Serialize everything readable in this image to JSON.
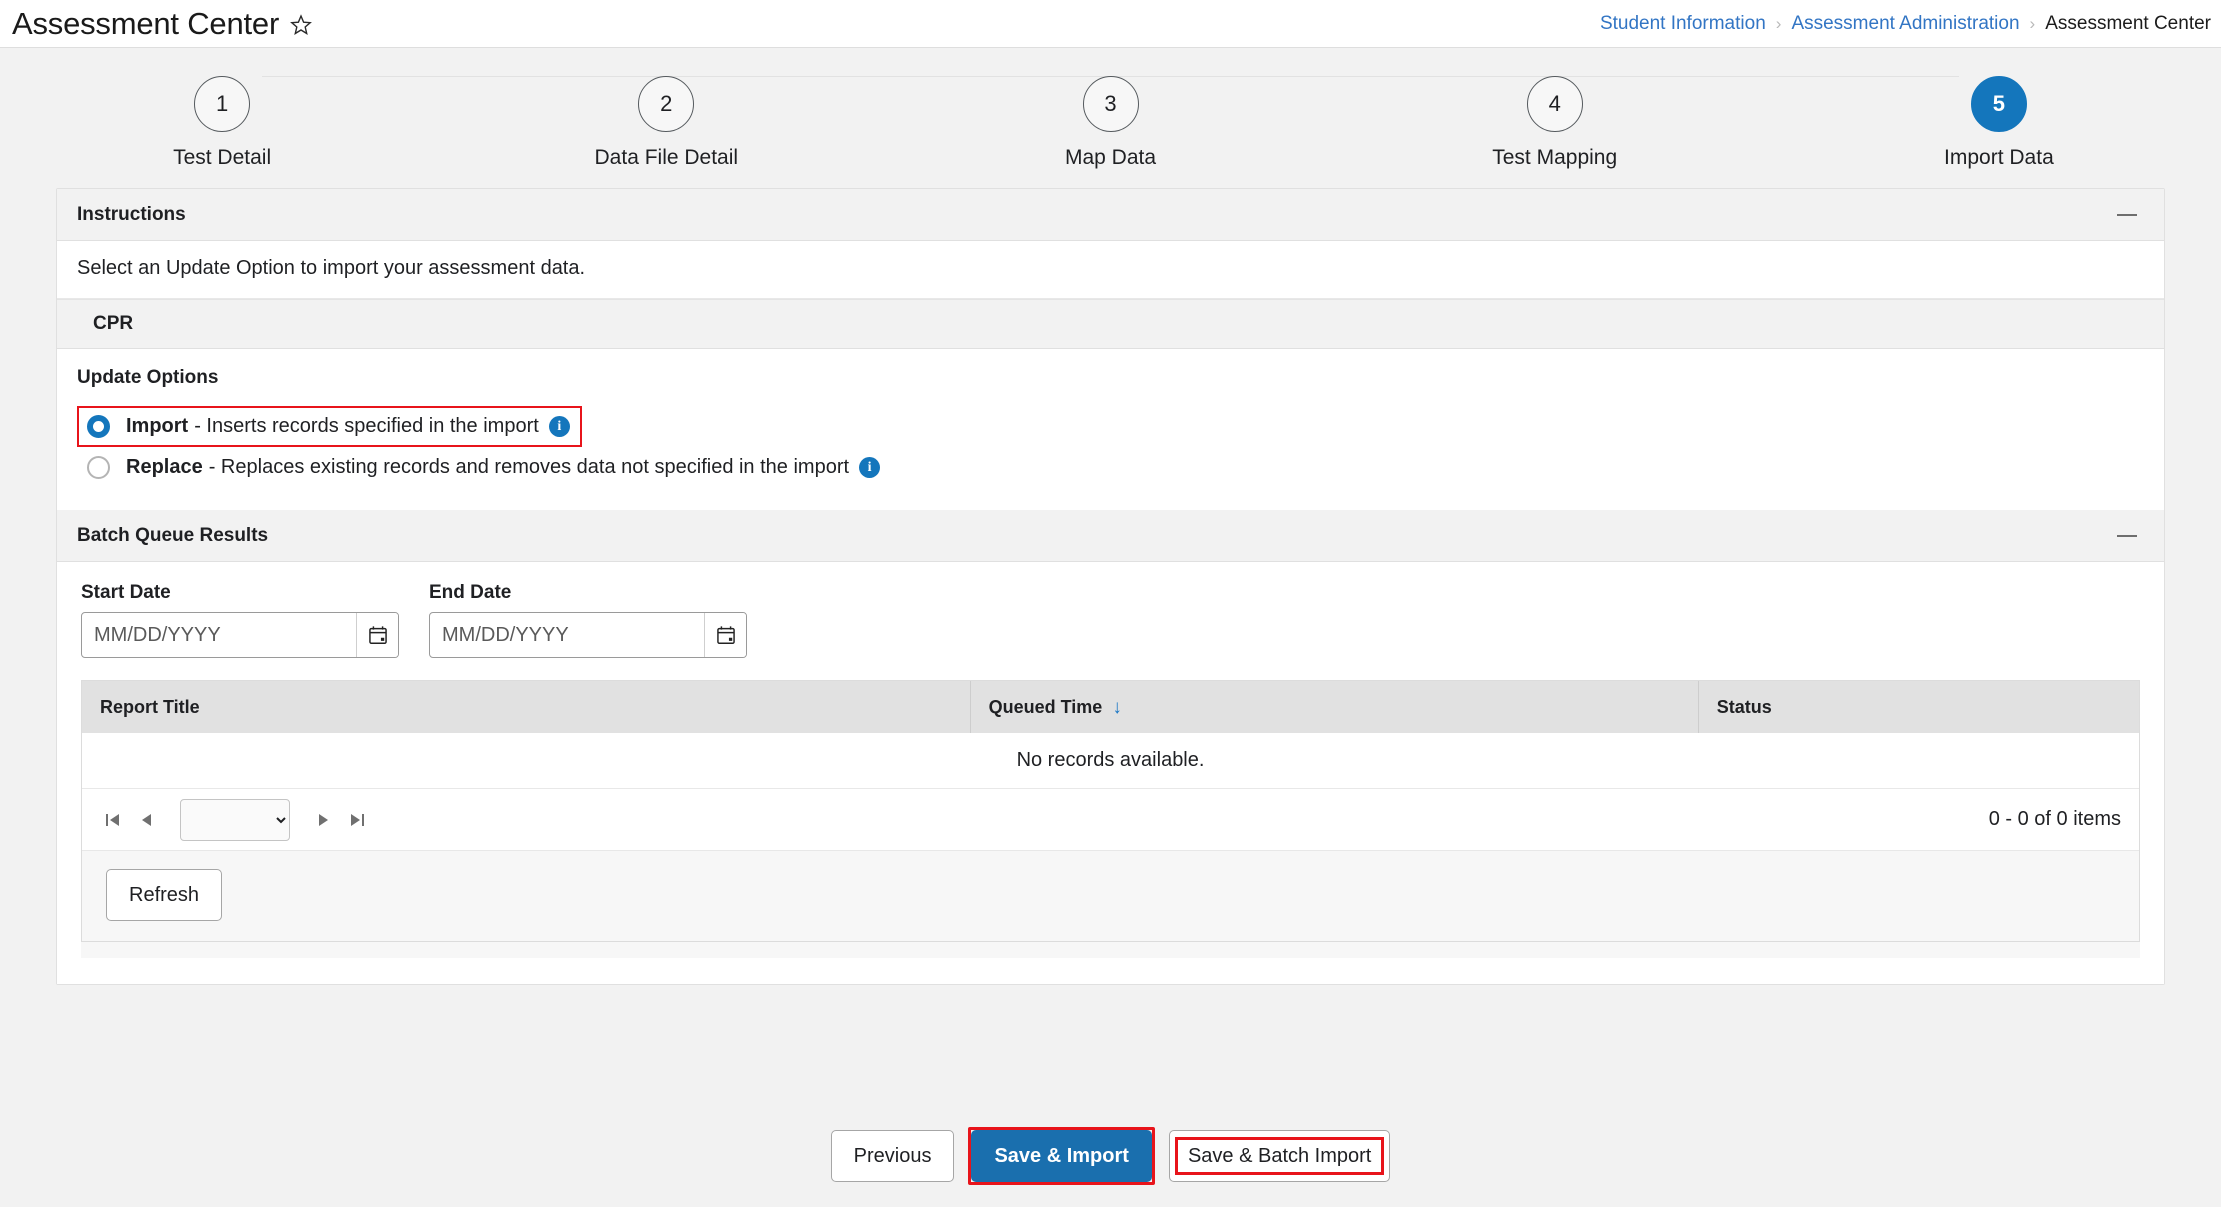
{
  "header": {
    "title": "Assessment Center",
    "favorite_icon": "star-icon",
    "breadcrumb": {
      "items": [
        "Student Information",
        "Assessment Administration",
        "Assessment Center"
      ],
      "separator": "›"
    }
  },
  "stepper": {
    "steps": [
      {
        "number": "1",
        "label": "Test Detail",
        "active": false
      },
      {
        "number": "2",
        "label": "Data File Detail",
        "active": false
      },
      {
        "number": "3",
        "label": "Map Data",
        "active": false
      },
      {
        "number": "4",
        "label": "Test Mapping",
        "active": false
      },
      {
        "number": "5",
        "label": "Import Data",
        "active": true
      }
    ],
    "active_color": "#1476bc"
  },
  "instructions": {
    "panel_title": "Instructions",
    "collapse_icon": "minus-icon",
    "body_text": "Select an Update Option to import your assessment data."
  },
  "cpr": {
    "section_title": "CPR",
    "update_options_label": "Update Options",
    "options": [
      {
        "name": "Import",
        "description": "- Inserts records specified in the import",
        "selected": true,
        "highlighted": true,
        "info_icon": "info-icon"
      },
      {
        "name": "Replace",
        "description": "- Replaces existing records and removes data not specified in the import",
        "selected": false,
        "highlighted": false,
        "info_icon": "info-icon"
      }
    ]
  },
  "batch_queue": {
    "panel_title": "Batch Queue Results",
    "collapse_icon": "minus-icon",
    "start_date": {
      "label": "Start Date",
      "value": "",
      "placeholder": "MM/DD/YYYY",
      "icon": "calendar-icon"
    },
    "end_date": {
      "label": "End Date",
      "value": "",
      "placeholder": "MM/DD/YYYY",
      "icon": "calendar-icon"
    },
    "grid": {
      "columns": [
        "Report Title",
        "Queued Time",
        "Status"
      ],
      "sorted_column": "Queued Time",
      "sort_direction": "descending",
      "sort_arrow": "↓",
      "rows": [],
      "empty_message": "No records available."
    },
    "pager": {
      "first_icon": "first-page-icon",
      "prev_icon": "previous-page-icon",
      "next_icon": "next-page-icon",
      "last_icon": "last-page-icon",
      "page_size_value": "",
      "page_size_options": [
        ""
      ],
      "item_count_text": "0 - 0 of 0 items"
    },
    "refresh_label": "Refresh"
  },
  "footer": {
    "previous_label": "Previous",
    "save_import_label": "Save & Import",
    "save_batch_import_label": "Save & Batch Import",
    "primary_color": "#1a6fae",
    "highlight_color": "#e8141b"
  }
}
